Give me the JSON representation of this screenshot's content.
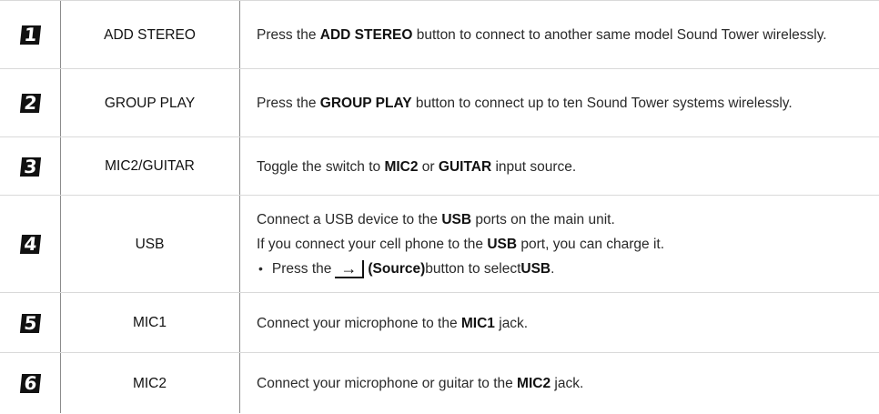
{
  "rows": [
    {
      "num": "1",
      "label": "ADD STEREO",
      "lines": [
        [
          {
            "t": "Press the "
          },
          {
            "t": "ADD STEREO",
            "b": true
          },
          {
            "t": " button to connect to another same model Sound Tower wirelessly."
          }
        ]
      ]
    },
    {
      "num": "2",
      "label": "GROUP PLAY",
      "lines": [
        [
          {
            "t": "Press the "
          },
          {
            "t": "GROUP PLAY",
            "b": true
          },
          {
            "t": " button to connect up to ten Sound Tower systems wirelessly."
          }
        ]
      ]
    },
    {
      "num": "3",
      "label": "MIC2/GUITAR",
      "lines": [
        [
          {
            "t": "Toggle the switch to "
          },
          {
            "t": "MIC2",
            "b": true
          },
          {
            "t": " or "
          },
          {
            "t": "GUITAR",
            "b": true
          },
          {
            "t": " input source."
          }
        ]
      ]
    },
    {
      "num": "4",
      "label": "USB",
      "lines": [
        [
          {
            "t": "Connect a USB device to the "
          },
          {
            "t": "USB",
            "b": true
          },
          {
            "t": " ports on the main unit."
          }
        ],
        [
          {
            "t": "If you connect your cell phone to the "
          },
          {
            "t": "USB",
            "b": true
          },
          {
            "t": " port, you can charge it."
          }
        ]
      ],
      "bullet": {
        "before": "Press the ",
        "icon": "source-arrow-icon",
        "icon_label": "(Source)",
        "after": " button to select ",
        "target": "USB",
        "end": "."
      }
    },
    {
      "num": "5",
      "label": "MIC1",
      "lines": [
        [
          {
            "t": "Connect your microphone to the "
          },
          {
            "t": "MIC1",
            "b": true
          },
          {
            "t": " jack."
          }
        ]
      ]
    },
    {
      "num": "6",
      "label": "MIC2",
      "lines": [
        [
          {
            "t": "Connect your microphone or guitar to the "
          },
          {
            "t": "MIC2",
            "b": true
          },
          {
            "t": " jack."
          }
        ]
      ]
    }
  ]
}
